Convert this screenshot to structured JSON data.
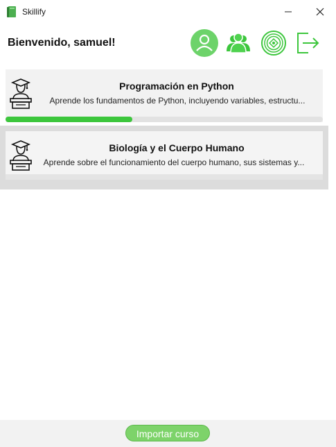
{
  "window": {
    "title": "Skillify",
    "app_icon": "book-icon",
    "controls": {
      "minimize_icon": "minimize-icon",
      "close_icon": "close-icon"
    }
  },
  "header": {
    "greeting": "Bienvenido, samuel!",
    "actions": [
      {
        "icon": "profile-icon"
      },
      {
        "icon": "users-icon"
      },
      {
        "icon": "badge-icon"
      },
      {
        "icon": "logout-icon"
      }
    ]
  },
  "courses": [
    {
      "icon": "teacher-podium-icon",
      "title": "Programación en Python",
      "description": "Aprende los fundamentos de Python, incluyendo variables, estructu...",
      "progress": 0.4
    },
    {
      "icon": "teacher-podium-icon",
      "title": "Biología y el Cuerpo Humano",
      "description": "Aprende sobre el funcionamiento del cuerpo humano, sus sistemas y..."
    }
  ],
  "footer": {
    "import_label": "Importar curso"
  },
  "colors": {
    "accent": "#3cc63c",
    "button": "#7dd36a",
    "icon_green": "#4caf50"
  }
}
